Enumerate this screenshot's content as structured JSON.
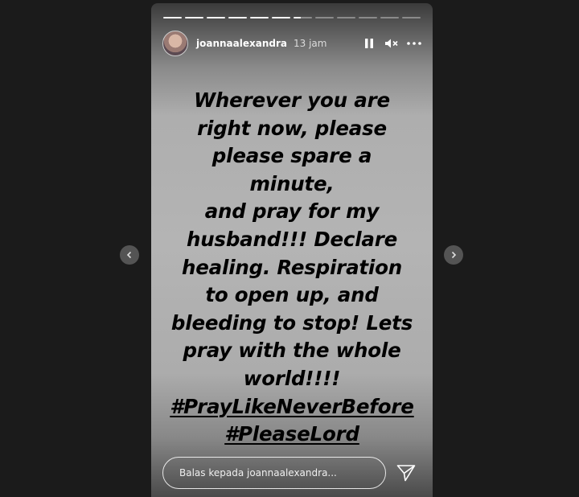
{
  "story": {
    "progress": {
      "total": 12,
      "completed": 6,
      "active_fraction": 0.4
    },
    "user": {
      "username": "joannaalexandra",
      "time_ago": "13 jam"
    },
    "controls": {
      "pause_icon": "pause-icon",
      "mute_icon": "muted-speaker-icon",
      "more_icon": "more-options-icon"
    },
    "text_lines": [
      "Wherever you are",
      "right now, please",
      "please spare a minute,",
      "and pray for my",
      "husband!!! Declare",
      "healing. Respiration",
      "to open up, and",
      "bleeding to stop! Lets",
      "pray with the whole",
      "world!!!!"
    ],
    "hashtags": [
      "#PrayLikeNeverBefore",
      "#PleaseLord"
    ],
    "reply": {
      "placeholder": "Balas kepada joannaalexandra...",
      "send_icon": "send-icon"
    }
  },
  "navigation": {
    "previous_icon": "chevron-left-icon",
    "next_icon": "chevron-right-icon"
  },
  "colors": {
    "background": "#1b1b1b",
    "story_gray": "#b4b4b4",
    "text": "#000000",
    "ui": "#ffffff"
  }
}
